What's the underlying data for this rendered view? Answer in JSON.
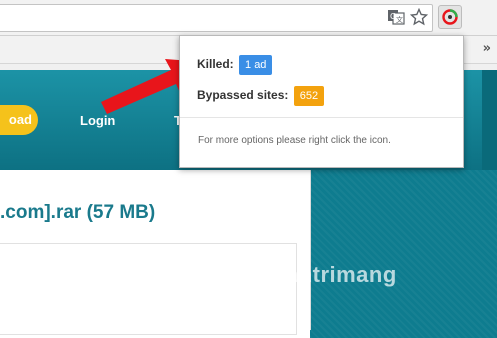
{
  "toolbar": {
    "icons": [
      "translate-icon",
      "star-icon",
      "extension-icon"
    ]
  },
  "bookmarks": {
    "overflow": "»"
  },
  "site": {
    "download_label": "oad",
    "nav": [
      "Login",
      "T"
    ],
    "file_title": ".com].rar (57 MB)"
  },
  "popup": {
    "killed_label": "Killed:",
    "killed_value": "1 ad",
    "bypassed_label": "Bypassed sites:",
    "bypassed_value": "652",
    "note": "For more options please right click the icon."
  },
  "watermark": {
    "text": "uantrimang"
  },
  "colors": {
    "teal": "#1c93a6",
    "badge_blue": "#3a8ee6",
    "badge_orange": "#f3a20e",
    "arrow_red": "#e8151b",
    "download_yellow": "#f5c21b"
  }
}
